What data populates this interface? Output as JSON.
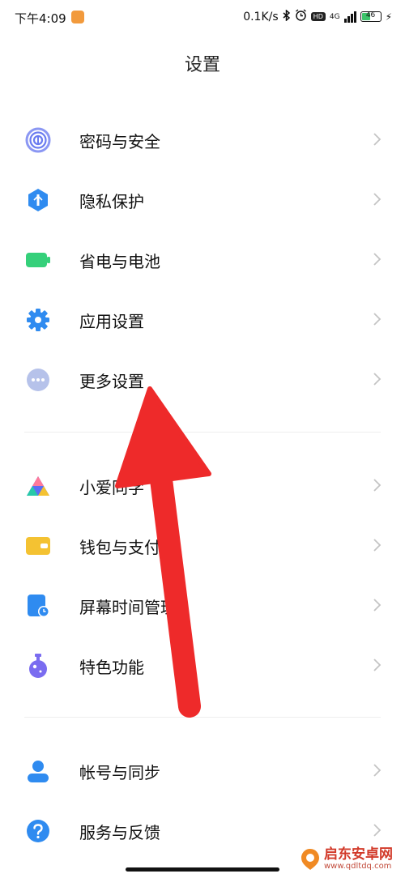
{
  "status_bar": {
    "time": "下午4:09",
    "net_speed": "0.1K/s",
    "hd_badge": "HD",
    "network_type": "4G",
    "battery_level": "46",
    "battery_fraction": 0.46
  },
  "page_title": "设置",
  "groups": [
    {
      "items": [
        {
          "label": "密码与安全",
          "icon": "fingerprint-icon",
          "color": "#6b7cf0"
        },
        {
          "label": "隐私保护",
          "icon": "privacy-shield-icon",
          "color": "#2f8bf0"
        },
        {
          "label": "省电与电池",
          "icon": "battery-icon",
          "color": "#35d07a"
        },
        {
          "label": "应用设置",
          "icon": "gear-icon",
          "color": "#2f8bf0"
        },
        {
          "label": "更多设置",
          "icon": "more-dots-icon",
          "color": "#a9b7e6"
        }
      ]
    },
    {
      "items": [
        {
          "label": "小爱同学",
          "icon": "xiaoai-icon",
          "color": "#5b6cf5"
        },
        {
          "label": "钱包与支付",
          "icon": "wallet-icon",
          "color": "#f4c232"
        },
        {
          "label": "屏幕时间管理",
          "icon": "screen-time-icon",
          "color": "#2f8bf0"
        },
        {
          "label": "特色功能",
          "icon": "feature-flask-icon",
          "color": "#7a6cf0"
        }
      ]
    },
    {
      "items": [
        {
          "label": "帐号与同步",
          "icon": "account-icon",
          "color": "#2f8bf0"
        },
        {
          "label": "服务与反馈",
          "icon": "help-icon",
          "color": "#2f8bf0"
        }
      ]
    }
  ],
  "annotation_arrow_color": "#ee2a2a",
  "watermark": {
    "title": "启东安卓网",
    "url": "www.qdltdq.com"
  }
}
